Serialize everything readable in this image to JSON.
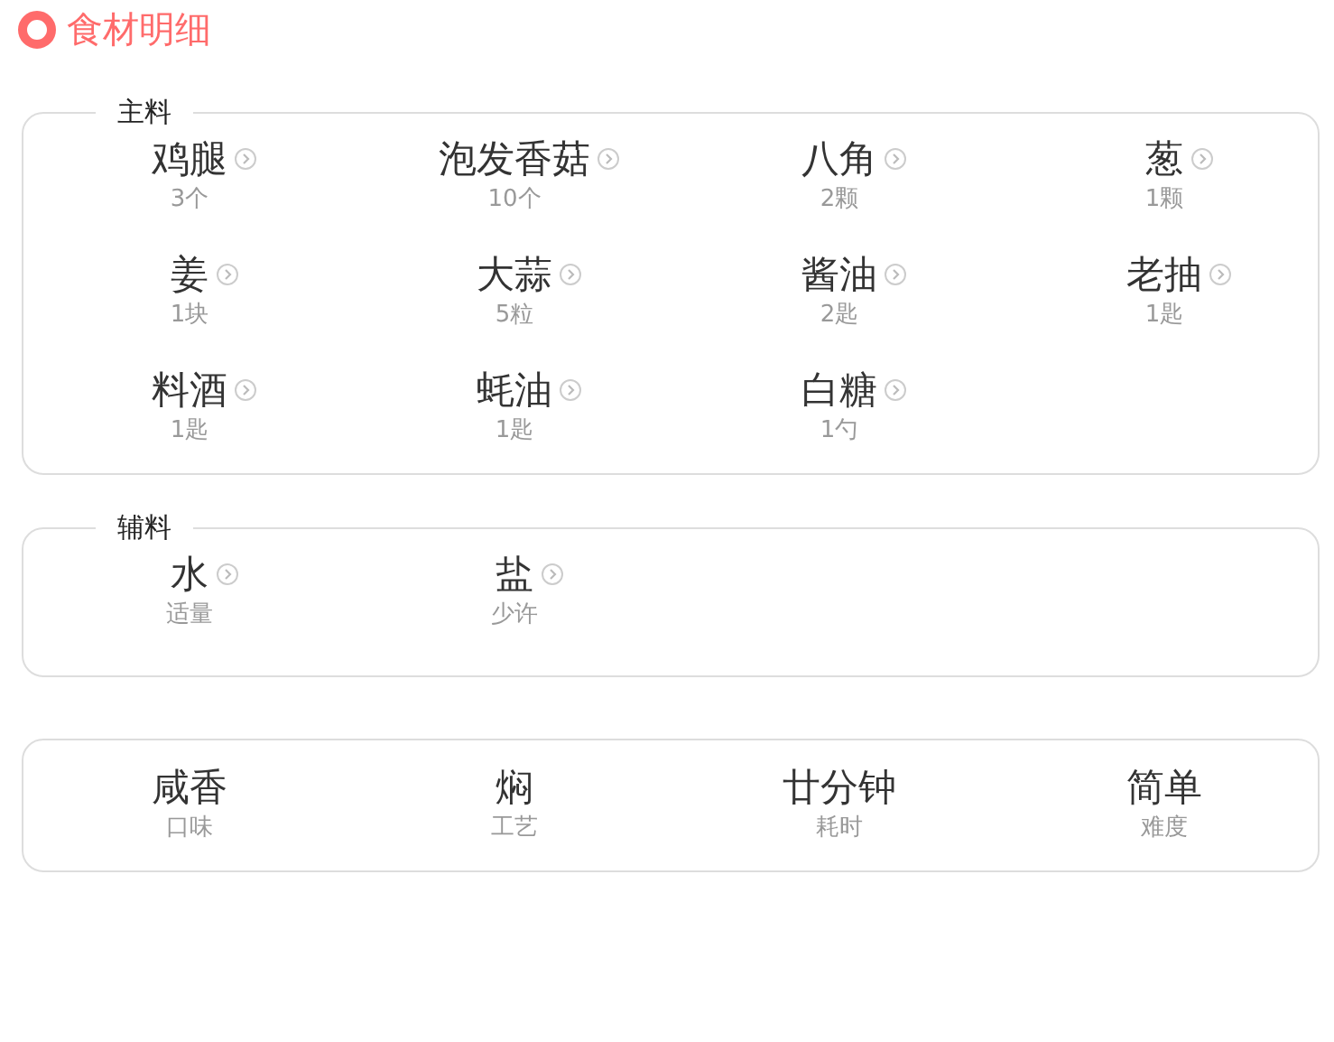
{
  "title": "食材明细",
  "sections": [
    {
      "legend": "主料",
      "items": [
        {
          "name": "鸡腿",
          "amount": "3个"
        },
        {
          "name": "泡发香菇",
          "amount": "10个"
        },
        {
          "name": "八角",
          "amount": "2颗"
        },
        {
          "name": "葱",
          "amount": "1颗"
        },
        {
          "name": "姜",
          "amount": "1块"
        },
        {
          "name": "大蒜",
          "amount": "5粒"
        },
        {
          "name": "酱油",
          "amount": "2匙"
        },
        {
          "name": "老抽",
          "amount": "1匙"
        },
        {
          "name": "料酒",
          "amount": "1匙"
        },
        {
          "name": "蚝油",
          "amount": "1匙"
        },
        {
          "name": "白糖",
          "amount": "1勺"
        }
      ]
    },
    {
      "legend": "辅料",
      "items": [
        {
          "name": "水",
          "amount": "适量"
        },
        {
          "name": "盐",
          "amount": "少许"
        }
      ]
    }
  ],
  "summary": [
    {
      "value": "咸香",
      "label": "口味"
    },
    {
      "value": "焖",
      "label": "工艺"
    },
    {
      "value": "廿分钟",
      "label": "耗时"
    },
    {
      "value": "简单",
      "label": "难度"
    }
  ]
}
